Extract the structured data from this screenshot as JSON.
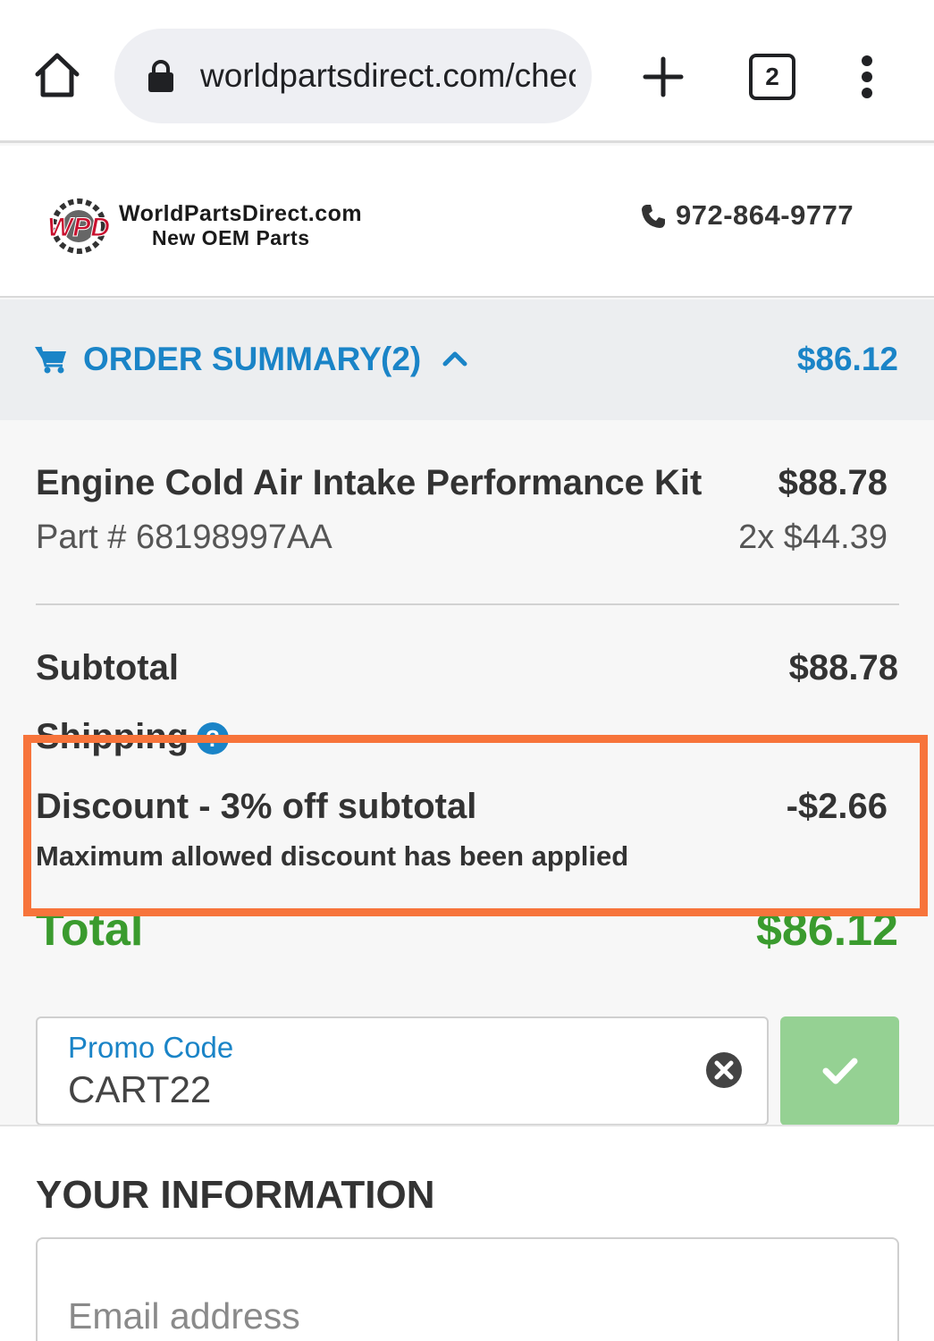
{
  "browser": {
    "url": "worldpartsdirect.com/checkout",
    "tab_count": "2"
  },
  "site": {
    "brand_name": "WorldPartsDirect.com",
    "tagline": "New OEM Parts",
    "phone": "972-864-9777"
  },
  "order_summary": {
    "label": "ORDER SUMMARY",
    "count": "(2)",
    "total": "$86.12"
  },
  "item": {
    "name": "Engine Cold Air Intake Performance Kit",
    "price": "$88.78",
    "part_number": "Part # 68198997AA",
    "quantity_price": "2x $44.39"
  },
  "totals": {
    "subtotal_label": "Subtotal",
    "subtotal_value": "$88.78",
    "shipping_label": "Shipping",
    "discount_label": "Discount - 3% off subtotal",
    "discount_value": "-$2.66",
    "discount_note": "Maximum allowed discount has been applied",
    "total_label": "Total",
    "total_value": "$86.12"
  },
  "promo": {
    "label": "Promo Code",
    "value": "CART22"
  },
  "your_information": {
    "title": "YOUR INFORMATION",
    "email_placeholder": "Email address"
  },
  "colors": {
    "accent_blue": "#1a84c7",
    "total_green": "#3a9b2e",
    "highlight_orange": "#f7743b",
    "apply_green": "#95d193"
  }
}
